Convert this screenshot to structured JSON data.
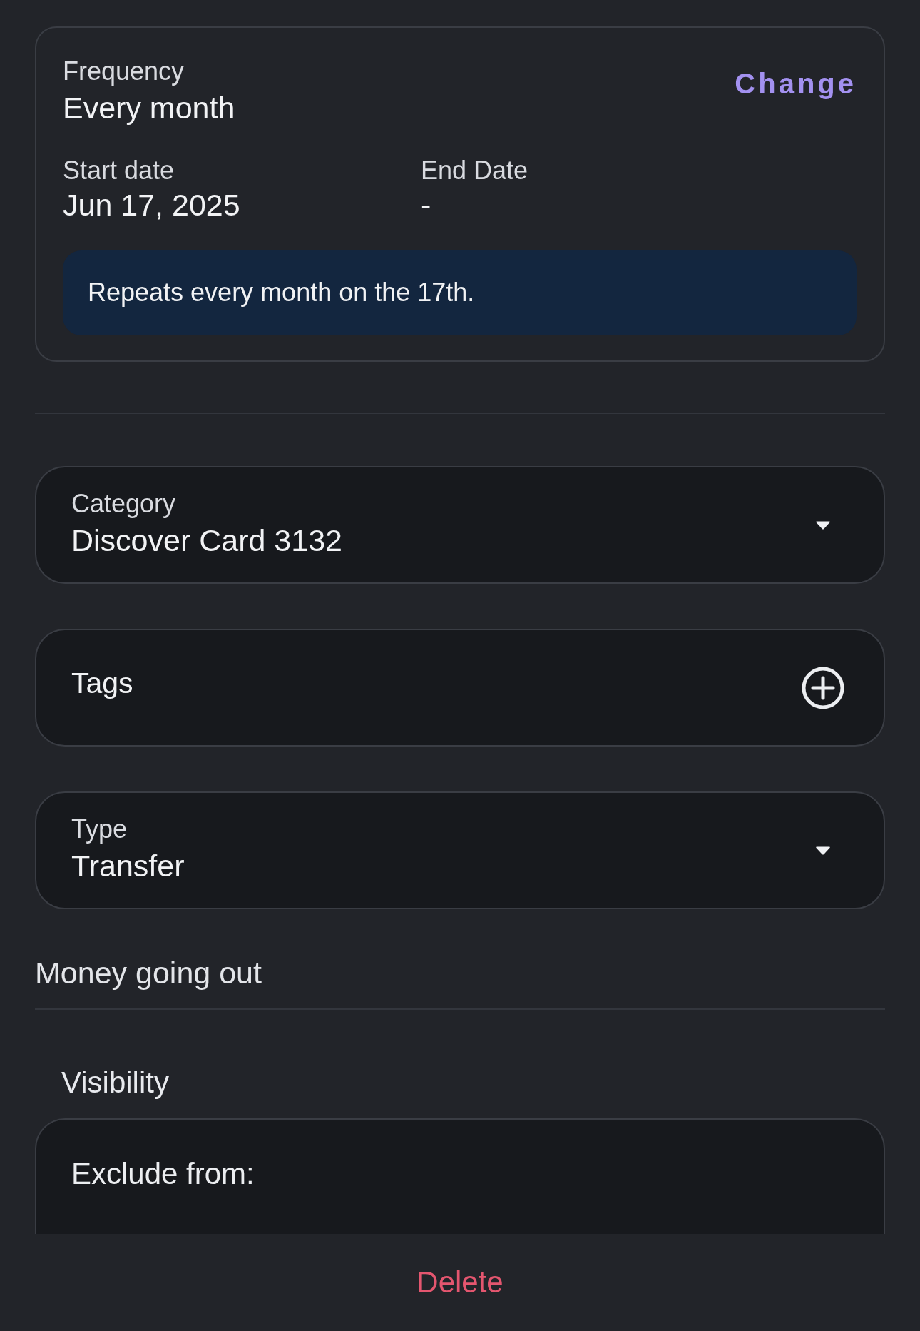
{
  "recurrence": {
    "frequency_label": "Frequency",
    "frequency": "Every month",
    "change_button": "Change",
    "start_label": "Start date",
    "start_date": "Jun 17, 2025",
    "end_label": "End Date",
    "end_date": "-",
    "summary": "Repeats every month on the 17th."
  },
  "fields": [
    {
      "kind": "dropdown",
      "label": "Category",
      "value": "Discover Card 3132"
    },
    {
      "kind": "tags",
      "label": "Tags"
    },
    {
      "kind": "dropdown",
      "label": "Type",
      "value": "Transfer"
    }
  ],
  "type_note": "Money going out",
  "visibility": {
    "title": "Visibility",
    "exclude_label": "Exclude from:"
  },
  "delete_button": "Delete"
}
